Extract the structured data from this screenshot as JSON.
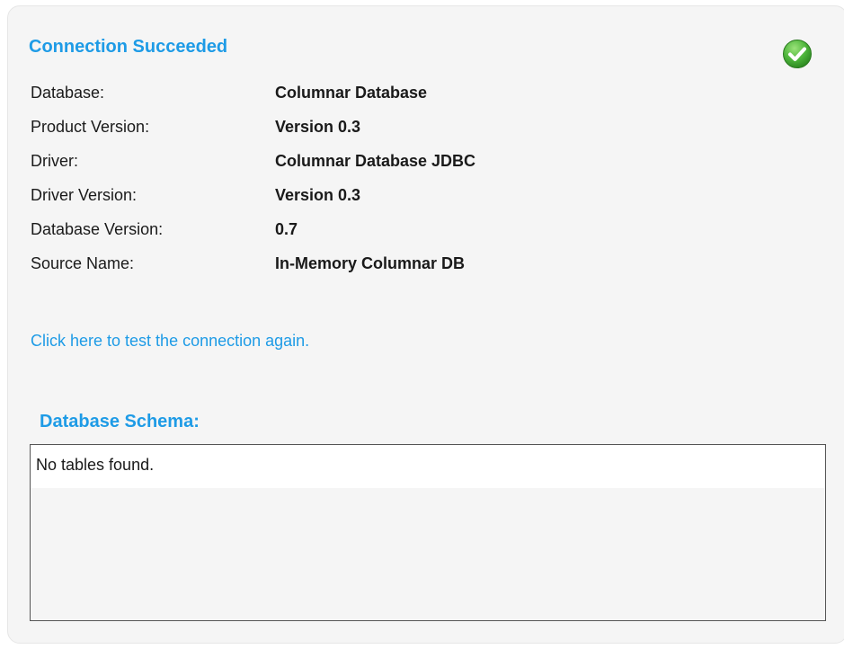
{
  "status": {
    "title": "Connection Succeeded",
    "icon": "check-circle-icon",
    "color": "#1e9be6"
  },
  "info": [
    {
      "label": "Database:",
      "value": "Columnar Database"
    },
    {
      "label": "Product Version:",
      "value": "Version 0.3"
    },
    {
      "label": "Driver:",
      "value": "Columnar Database JDBC"
    },
    {
      "label": "Driver Version:",
      "value": "Version 0.3"
    },
    {
      "label": "Database Version:",
      "value": "0.7"
    },
    {
      "label": "Source Name:",
      "value": "In-Memory Columnar DB"
    }
  ],
  "retest_link": "Click here to test the connection again.",
  "schema": {
    "title": "Database Schema:",
    "content": "No tables found."
  }
}
